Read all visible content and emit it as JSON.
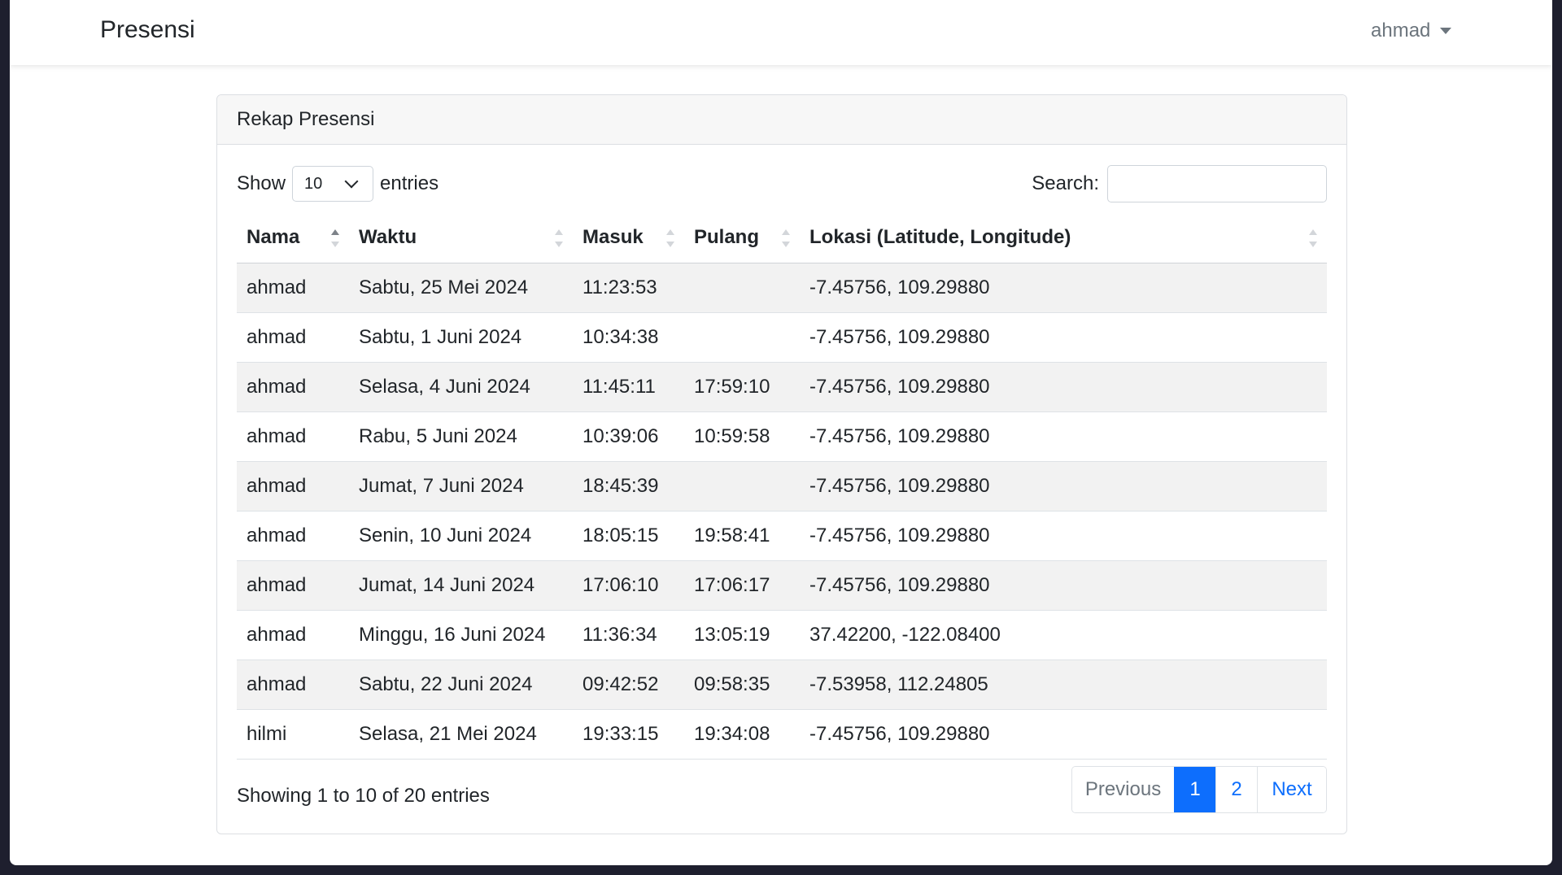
{
  "navbar": {
    "brand": "Presensi",
    "user": "ahmad"
  },
  "card": {
    "title": "Rekap Presensi"
  },
  "length": {
    "show_label": "Show",
    "value": "10",
    "entries_label": "entries"
  },
  "search": {
    "label": "Search:",
    "value": "",
    "placeholder": ""
  },
  "table": {
    "columns": [
      "Nama",
      "Waktu",
      "Masuk",
      "Pulang",
      "Lokasi (Latitude, Longitude)"
    ],
    "rows": [
      [
        "ahmad",
        "Sabtu, 25 Mei 2024",
        "11:23:53",
        "",
        "-7.45756, 109.29880"
      ],
      [
        "ahmad",
        "Sabtu, 1 Juni 2024",
        "10:34:38",
        "",
        "-7.45756, 109.29880"
      ],
      [
        "ahmad",
        "Selasa, 4 Juni 2024",
        "11:45:11",
        "17:59:10",
        "-7.45756, 109.29880"
      ],
      [
        "ahmad",
        "Rabu, 5 Juni 2024",
        "10:39:06",
        "10:59:58",
        "-7.45756, 109.29880"
      ],
      [
        "ahmad",
        "Jumat, 7 Juni 2024",
        "18:45:39",
        "",
        "-7.45756, 109.29880"
      ],
      [
        "ahmad",
        "Senin, 10 Juni 2024",
        "18:05:15",
        "19:58:41",
        "-7.45756, 109.29880"
      ],
      [
        "ahmad",
        "Jumat, 14 Juni 2024",
        "17:06:10",
        "17:06:17",
        "-7.45756, 109.29880"
      ],
      [
        "ahmad",
        "Minggu, 16 Juni 2024",
        "11:36:34",
        "13:05:19",
        "37.42200, -122.08400"
      ],
      [
        "ahmad",
        "Sabtu, 22 Juni 2024",
        "09:42:52",
        "09:58:35",
        "-7.53958, 112.24805"
      ],
      [
        "hilmi",
        "Selasa, 21 Mei 2024",
        "19:33:15",
        "19:34:08",
        "-7.45756, 109.29880"
      ]
    ]
  },
  "footer": {
    "info": "Showing 1 to 10 of 20 entries",
    "pagination": {
      "previous": "Previous",
      "pages": [
        "1",
        "2"
      ],
      "next": "Next"
    }
  },
  "colors": {
    "primary": "#0d6efd",
    "stripe": "#f2f2f2",
    "muted": "#6c757d"
  }
}
